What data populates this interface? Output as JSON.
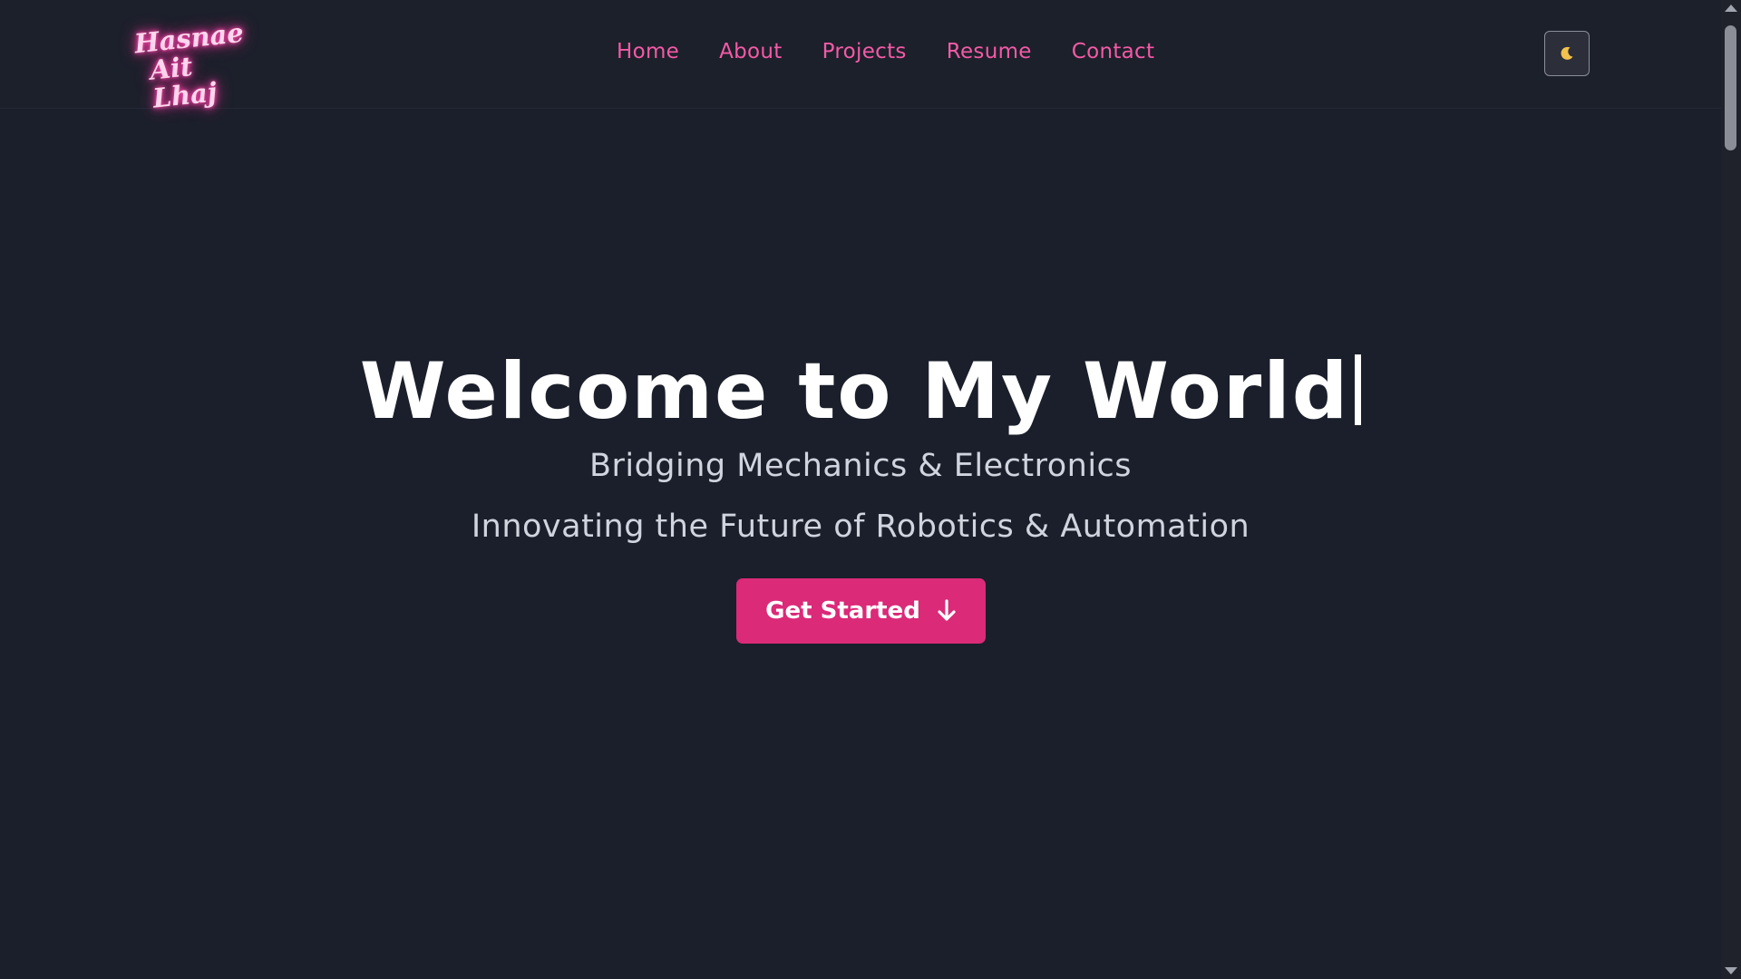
{
  "header": {
    "logo": {
      "line1": "Hasnae",
      "line2": "Ait Lhaj"
    },
    "nav": [
      {
        "label": "Home"
      },
      {
        "label": "About"
      },
      {
        "label": "Projects"
      },
      {
        "label": "Resume"
      },
      {
        "label": "Contact"
      }
    ],
    "theme_toggle": {
      "icon": "moon-icon",
      "glyph": "🌙"
    }
  },
  "hero": {
    "title": "Welcome to My World",
    "subtitle1": "Bridging Mechanics & Electronics",
    "subtitle2": "Innovating the Future of Robotics & Automation",
    "cta_label": "Get Started",
    "cta_icon": "arrow-down-icon"
  },
  "colors": {
    "background": "#1b1f2b",
    "accent": "#da2a78",
    "nav_link": "#f45aa6",
    "logo_glow": "#ff4fb0"
  }
}
